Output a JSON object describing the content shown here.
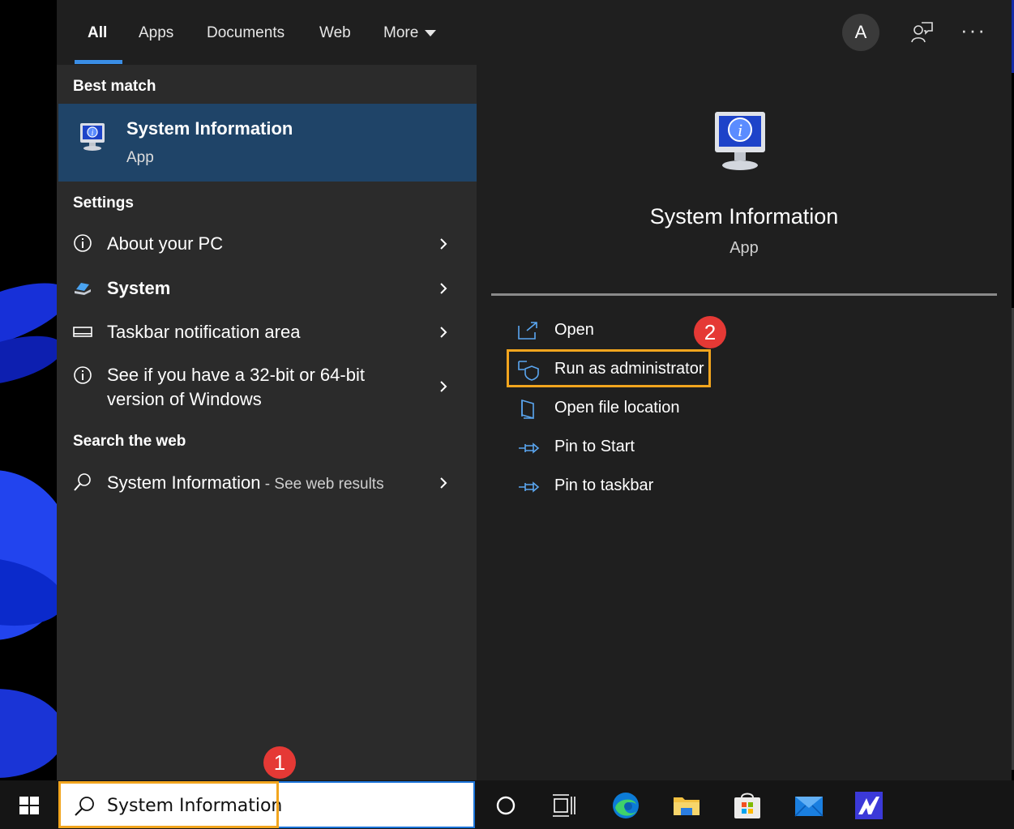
{
  "tabs": [
    {
      "label": "All"
    },
    {
      "label": "Apps"
    },
    {
      "label": "Documents"
    },
    {
      "label": "Web"
    },
    {
      "label": "More"
    }
  ],
  "account": {
    "initial": "A"
  },
  "left": {
    "best_match_heading": "Best match",
    "best_match": {
      "title": "System Information",
      "subtitle": "App"
    },
    "settings_heading": "Settings",
    "settings": [
      {
        "label": "About your PC",
        "icon": "info-icon"
      },
      {
        "label": "System",
        "icon": "laptop-icon"
      },
      {
        "label": "Taskbar notification area",
        "icon": "taskbar-icon"
      },
      {
        "label": "See if you have a 32-bit or 64-bit version of Windows",
        "icon": "info-icon"
      }
    ],
    "web_heading": "Search the web",
    "web_result": {
      "label": "System Information",
      "sub": " - See web results"
    }
  },
  "preview": {
    "title": "System Information",
    "subtitle": "App",
    "actions": [
      {
        "label": "Open",
        "icon": "open-icon"
      },
      {
        "label": "Run as administrator",
        "icon": "shield-icon"
      },
      {
        "label": "Open file location",
        "icon": "folder-location-icon"
      },
      {
        "label": "Pin to Start",
        "icon": "pin-icon"
      },
      {
        "label": "Pin to taskbar",
        "icon": "pin-icon"
      }
    ]
  },
  "badges": {
    "first": "1",
    "second": "2"
  },
  "search": {
    "value": "System Information"
  },
  "colors": {
    "highlight": "#f2a51e",
    "accent": "#3a8ee6",
    "selection": "#1f4468",
    "badge": "#e53935"
  }
}
